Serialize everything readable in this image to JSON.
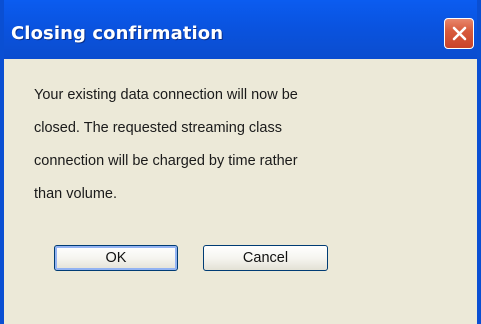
{
  "dialog": {
    "title": "Closing confirmation",
    "message": "Your existing data connection will now be\nclosed. The requested streaming class\nconnection will be charged by time rather\nthan volume.",
    "ok_label": "OK",
    "cancel_label": "Cancel",
    "close_icon": "close-icon"
  },
  "colors": {
    "titlebar": "#0a53df",
    "frame": "#0a4fd3",
    "dialog_background": "#ece9d8",
    "close_button": "#d85c3d"
  }
}
